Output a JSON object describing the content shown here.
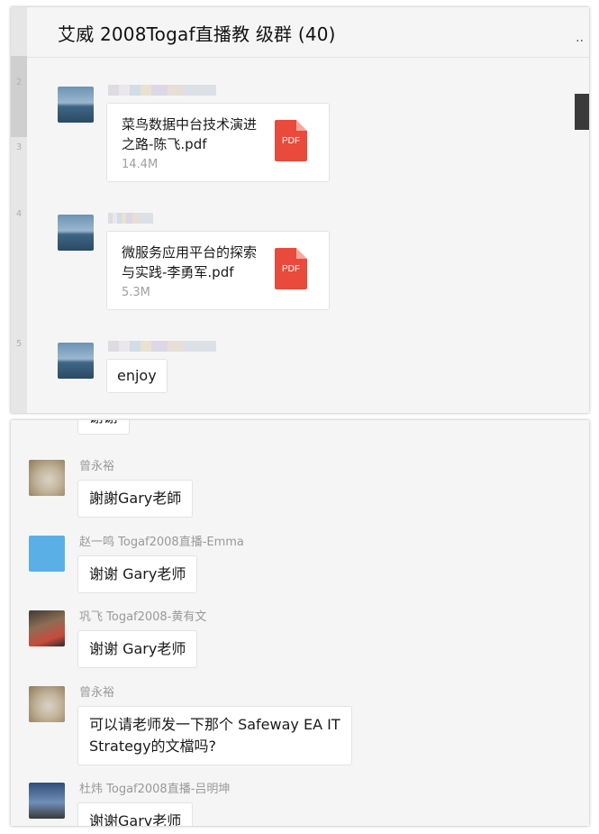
{
  "header": {
    "title": "艾威 2008Togaf直播教   级群 (40)",
    "more_icon": "more-dots-icon"
  },
  "left_strip": {
    "numbers": [
      "2",
      "3",
      "4",
      "5"
    ]
  },
  "top_messages": [
    {
      "avatar": "lake-avatar",
      "file": {
        "name": "菜鸟数据中台技术演进之路-陈飞.pdf",
        "size": "14.4M",
        "icon_label": "PDF"
      }
    },
    {
      "avatar": "lake-avatar",
      "file": {
        "name": "微服务应用平台的探索与实践-李勇军.pdf",
        "size": "5.3M",
        "icon_label": "PDF"
      }
    },
    {
      "avatar": "lake-avatar",
      "text": "enjoy"
    }
  ],
  "bottom_messages": [
    {
      "sender": "",
      "text": "谢谢"
    },
    {
      "sender": "曾永裕",
      "text": "謝謝Gary老師"
    },
    {
      "sender": "赵一鸣 Togaf2008直播-Emma",
      "text": "谢谢 Gary老师"
    },
    {
      "sender": "巩飞 Togaf2008-黄有文",
      "text": "谢谢 Gary老师"
    },
    {
      "sender": "曾永裕",
      "text": "可以请老师发一下那个 Safeway EA IT\nStrategy的文檔吗?"
    },
    {
      "sender": "杜炜 Togaf2008直播-吕明坤",
      "text": "谢谢Gary老师"
    }
  ],
  "colors": {
    "pdf_red": "#e84a3b",
    "bubble_bg": "#ffffff",
    "chat_bg": "#f5f5f5",
    "sender_gray": "#999999"
  }
}
